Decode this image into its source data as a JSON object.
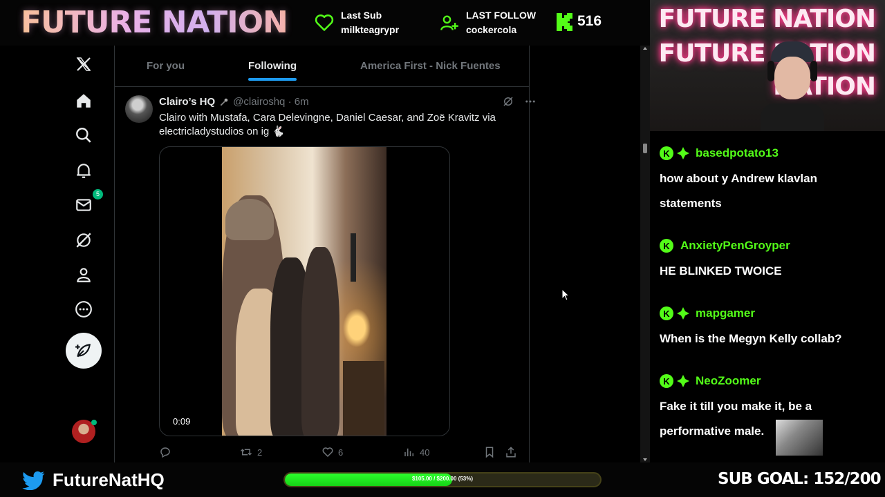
{
  "overlay": {
    "logo": "FUTURE NATION",
    "last_sub_label": "Last Sub",
    "last_sub_user": "milkteagrypr",
    "last_follow_label": "LAST FOLLOW",
    "last_follow_user": "cockercola",
    "kick_followers": "516",
    "accent": "#53fc18"
  },
  "nav": {
    "items": [
      "x-logo",
      "home",
      "search",
      "notifications",
      "messages",
      "grok",
      "profile",
      "more"
    ],
    "messages_badge": "5"
  },
  "tabs": [
    {
      "label": "For you",
      "active": false
    },
    {
      "label": "Following",
      "active": true
    },
    {
      "label": "America First - Nick Fuentes",
      "active": false
    }
  ],
  "tweet": {
    "name": "Clairo’s HQ",
    "handle_time": "@clairoshq · 6m",
    "text": "Clairo with Mustafa, Cara Delevingne, Daniel Caesar, and Zoë Kravitz via electricladystudios on ig 🐇",
    "video_time": "0:09",
    "reposts": "2",
    "likes": "6",
    "views": "40"
  },
  "webcam": {
    "neon_lines": [
      "FUTURE NATION",
      "FUTURE NATION",
      "NATION"
    ]
  },
  "chat": [
    {
      "user": "basedpotato13",
      "text": "how about y Andrew klavlan statements"
    },
    {
      "user": "AnxietyPenGroyper",
      "text": "HE BLINKED TWOICE"
    },
    {
      "user": "mapgamer",
      "text": "When is the Megyn Kelly collab?"
    },
    {
      "user": "NeoZoomer",
      "text": "Fake it till you make it, be a performative male."
    }
  ],
  "bottom": {
    "twitter_handle": "FutureNatHQ",
    "progress_label": "$105.00 / $200.00 (53%)",
    "progress_fraction": 0.53,
    "sub_goal": "SUB GOAL: 152/200"
  }
}
